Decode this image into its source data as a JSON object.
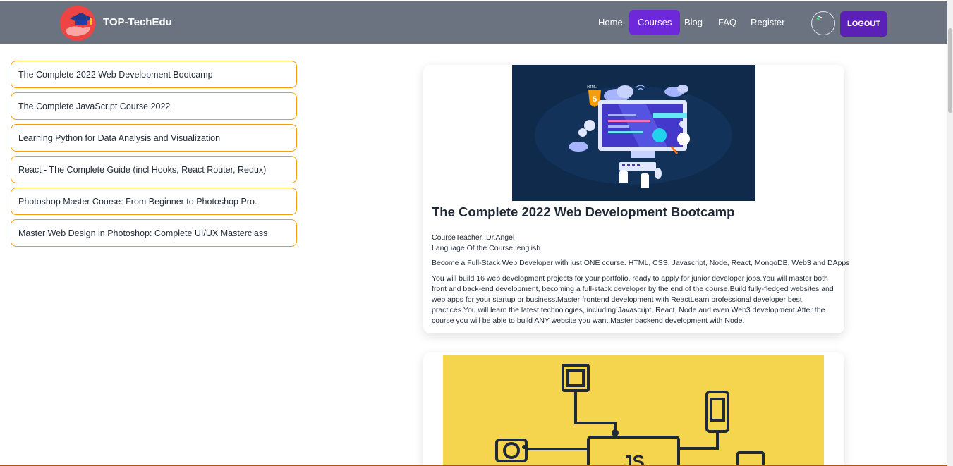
{
  "header": {
    "brand": "TOP-TechEdu",
    "nav": [
      "Home",
      "Courses",
      "Blog",
      "FAQ",
      "Register"
    ],
    "active_nav": "Courses",
    "logout": "LOGOUT"
  },
  "sidebar": {
    "items": [
      {
        "label": "The Complete 2022 Web Development Bootcamp"
      },
      {
        "label": "The Complete JavaScript Course 2022"
      },
      {
        "label": "Learning Python for Data Analysis and Visualization"
      },
      {
        "label": "React - The Complete Guide (incl Hooks, React Router, Redux)"
      },
      {
        "label": "Photoshop Master Course: From Beginner to Photoshop Pro."
      },
      {
        "label": "Master Web Design in Photoshop: Complete UI/UX Masterclass"
      }
    ]
  },
  "courses": [
    {
      "title": "The Complete 2022 Web Development Bootcamp",
      "teacher": "CourseTeacher :Dr.Angel",
      "language": "Language Of the Course :english",
      "summary": "Become a Full-Stack Web Developer with just ONE course. HTML, CSS, Javascript, Node, React, MongoDB, Web3 and DApps",
      "description": "You will build 16 web development projects for your portfolio, ready to apply for junior developer jobs.You will master both front and back-end development, becoming a full-stack developer by the end of the course.Build fully-fledged websites and web apps for your startup or business.Master frontend development with ReactLearn professional developer best practices.You will learn the latest technologies, including Javascript, React, Node and even Web3 development.After the course you will be able to build ANY website you want.Master backend development with Node.",
      "image_label": "HTML",
      "image_badge": "5"
    },
    {
      "image_label": "JS"
    }
  ],
  "colors": {
    "navbar": "#6b7280",
    "accent": "#5b21b6",
    "active_nav": "#6d28d9",
    "sidebar_border": "#f59e0b",
    "hero_bg": "#0f2a4a",
    "js_bg": "#f5d44e"
  }
}
